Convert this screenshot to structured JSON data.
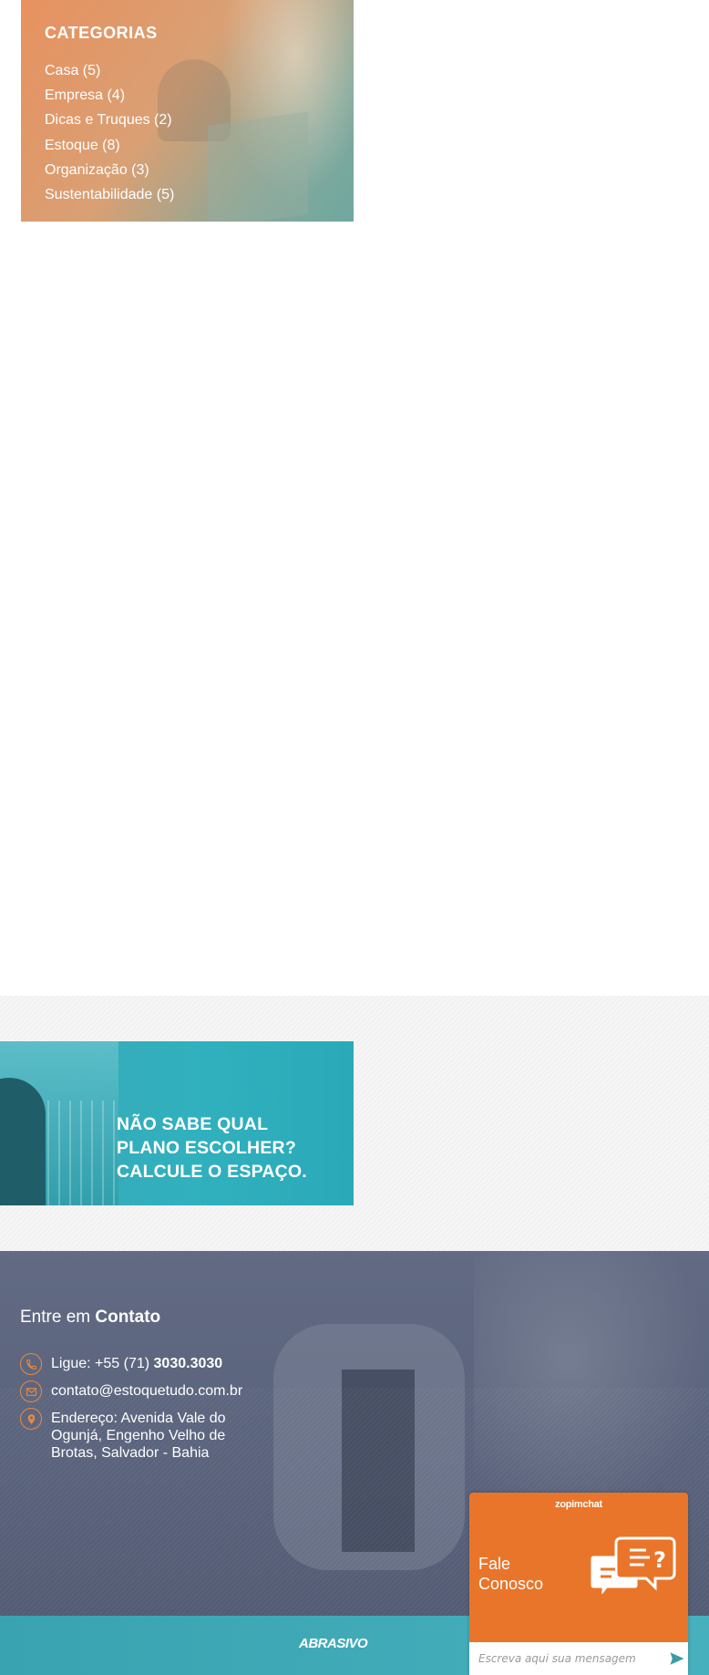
{
  "categories": {
    "title": "CATEGORIAS",
    "items": [
      {
        "label": "Casa (5)"
      },
      {
        "label": "Empresa (4)"
      },
      {
        "label": "Dicas e Truques (2)"
      },
      {
        "label": "Estoque (8)"
      },
      {
        "label": "Organização (3)"
      },
      {
        "label": "Sustentabilidade (5)"
      }
    ]
  },
  "banner": {
    "line1": "NÃO SABE QUAL",
    "line2": "PLANO ESCOLHER?",
    "line3": "CALCULE O ESPAÇO."
  },
  "footer": {
    "heading_prefix": "Entre em ",
    "heading_bold": "Contato",
    "phone_prefix": "Ligue: +55 (71) ",
    "phone_bold": "3030.3030",
    "email": "contato@estoquetudo.com.br",
    "address": "Endereço: Avenida Vale do Ogunjá, Engenho Velho de Brotas, Salvador - Bahia",
    "accent_color": "#e8893f"
  },
  "bottom_bar": {
    "logo": "ABRASIVO"
  },
  "chat": {
    "brand": "zopimchat",
    "title_line1": "Fale",
    "title_line2": "Conosco",
    "placeholder": "Escreva aqui sua mensagem",
    "color": "#e9752a"
  },
  "icons": {
    "phone": "phone-icon",
    "email": "envelope-icon",
    "address": "map-pin-icon",
    "send": "send-arrow-icon",
    "chat": "chat-bubbles-icon"
  }
}
